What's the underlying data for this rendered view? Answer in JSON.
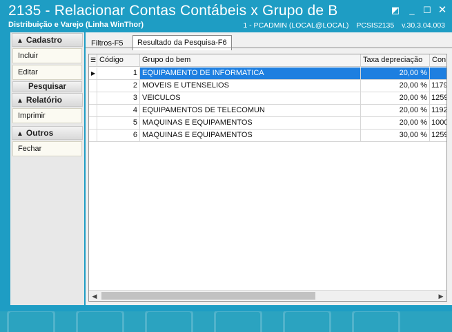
{
  "window": {
    "title": "2135 - Relacionar Contas Contábeis x Grupo de B",
    "subtitle": "Distribuição e Varejo (Linha WinThor)",
    "user_info": "1 - PCADMIN (LOCAL@LOCAL)",
    "routine": "PCSIS2135",
    "version": "v.30.3.04.003"
  },
  "sidebar": {
    "cadastro": "Cadastro",
    "incluir": "Incluir",
    "editar": "Editar",
    "pesquisar": "Pesquisar",
    "relatorio": "Relatório",
    "imprimir": "Imprimir",
    "outros": "Outros",
    "fechar": "Fechar"
  },
  "tabs": {
    "filtros": "Filtros-F5",
    "resultado": "Resultado da Pesquisa-F6"
  },
  "grid": {
    "headers": {
      "codigo": "Código",
      "grupo": "Grupo do bem",
      "taxa": "Taxa depreciação",
      "conta": "Con"
    },
    "rows": [
      {
        "codigo": "1",
        "grupo": "EQUIPAMENTO DE INFORMATICA",
        "taxa": "20,00 %",
        "conta": ""
      },
      {
        "codigo": "2",
        "grupo": "MOVEIS E UTENSELIOS",
        "taxa": "20,00 %",
        "conta": "1179"
      },
      {
        "codigo": "3",
        "grupo": "VEICULOS",
        "taxa": "20,00 %",
        "conta": "1259"
      },
      {
        "codigo": "4",
        "grupo": "EQUIPAMENTOS DE TELECOMUN",
        "taxa": "20,00 %",
        "conta": "1192"
      },
      {
        "codigo": "5",
        "grupo": "MAQUINAS E EQUIPAMENTOS",
        "taxa": "20,00 %",
        "conta": "1000"
      },
      {
        "codigo": "6",
        "grupo": "MAQUINAS E EQUIPAMENTOS",
        "taxa": "30,00 %",
        "conta": "1259"
      }
    ]
  },
  "colors": {
    "titlebar": "#1e9dc4",
    "selection": "#1e7fe0"
  }
}
